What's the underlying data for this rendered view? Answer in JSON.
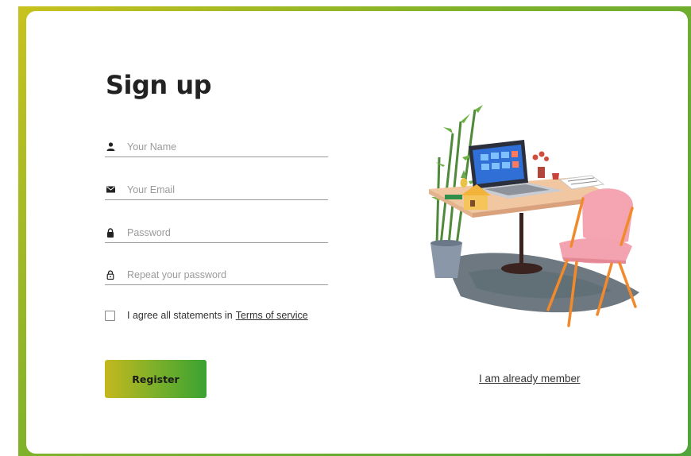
{
  "form": {
    "title": "Sign up",
    "name_placeholder": "Your Name",
    "email_placeholder": "Your Email",
    "password_placeholder": "Password",
    "repeat_password_placeholder": "Repeat your password",
    "agree_text": "I agree all statements in",
    "terms_link": "Terms of service",
    "register_label": "Register",
    "member_link": "I am already member"
  },
  "icons": {
    "name": "user-icon",
    "email": "envelope-icon",
    "password": "lock-icon",
    "repeat_password": "lock-outline-icon"
  },
  "colors": {
    "accent_start": "#c4b81e",
    "accent_end": "#3aa232"
  }
}
